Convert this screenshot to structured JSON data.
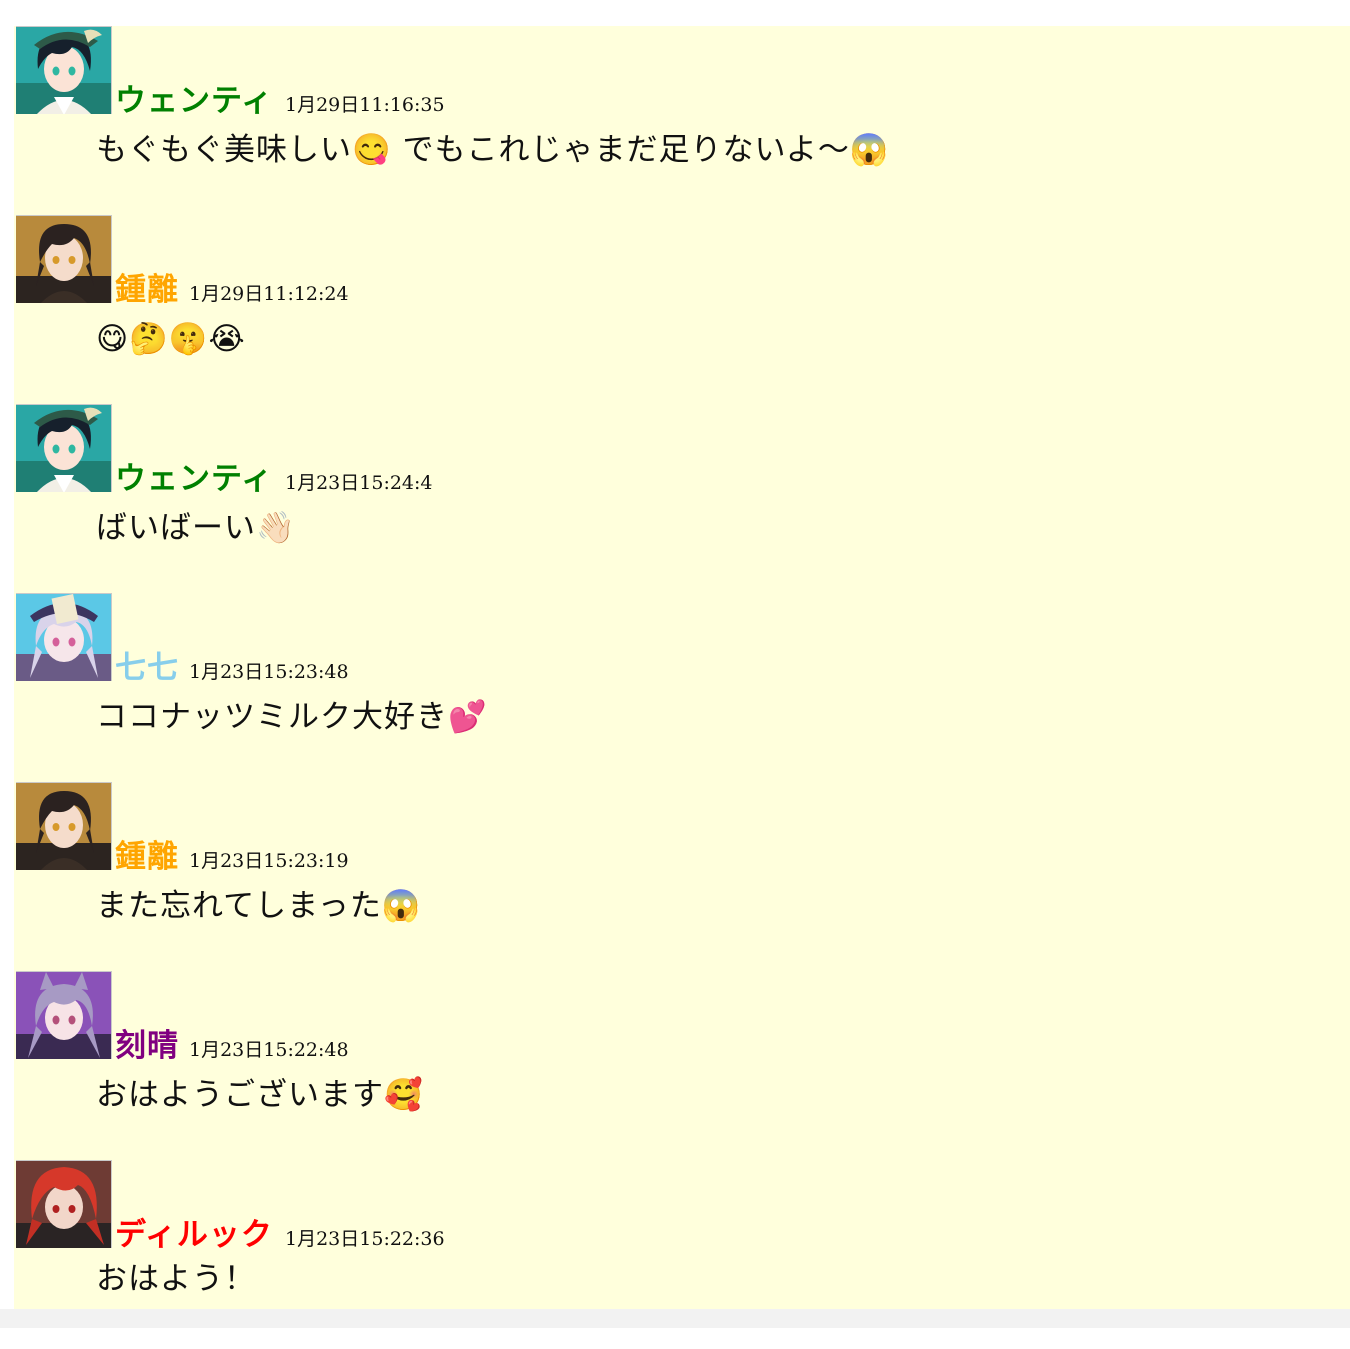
{
  "colors": {
    "board_bg": "#ffffdc",
    "venti": "#008000",
    "zhongli": "#ffa500",
    "qiqi": "#87ceeb",
    "keqing": "#800080",
    "diluc": "#ff0000"
  },
  "messages": [
    {
      "name": "ウェンティ",
      "name_color": "#008000",
      "time": "1月29日11:16:35",
      "avatar": "venti-avatar",
      "text": "もぐもぐ美味しい😋 でもこれじゃまだ足りないよ〜😱"
    },
    {
      "name": "鍾離",
      "name_color": "#ffa500",
      "time": "1月29日11:12:24",
      "avatar": "zhongli-avatar",
      "text": "😋🤔🤫😭"
    },
    {
      "name": "ウェンティ",
      "name_color": "#008000",
      "time": "1月23日15:24:4",
      "avatar": "venti-avatar",
      "text": "ばいばーい👋🏻"
    },
    {
      "name": "七七",
      "name_color": "#87ceeb",
      "time": "1月23日15:23:48",
      "avatar": "qiqi-avatar",
      "text": "ココナッツミルク大好き💕"
    },
    {
      "name": "鍾離",
      "name_color": "#ffa500",
      "time": "1月23日15:23:19",
      "avatar": "zhongli-avatar",
      "text": "また忘れてしまった😱"
    },
    {
      "name": "刻晴",
      "name_color": "#800080",
      "time": "1月23日15:22:48",
      "avatar": "keqing-avatar",
      "text": "おはようございます🥰"
    },
    {
      "name": "ディルック",
      "name_color": "#ff0000",
      "time": "1月23日15:22:36",
      "avatar": "diluc-avatar",
      "text": "おはよう！"
    }
  ]
}
